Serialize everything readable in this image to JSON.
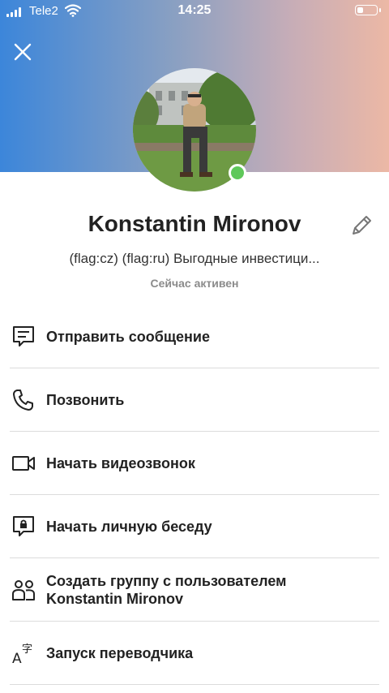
{
  "status_bar": {
    "carrier": "Tele2",
    "time": "14:25",
    "battery_level": 0.35
  },
  "profile": {
    "name": "Konstantin Mironov",
    "mood": "(flag:cz) (flag:ru) Выгодные инвестици...",
    "presence": "Сейчас активен",
    "online": true
  },
  "menu": {
    "items": [
      {
        "label": "Отправить сообщение",
        "icon": "chat-icon"
      },
      {
        "label": "Позвонить",
        "icon": "phone-icon"
      },
      {
        "label": "Начать видеозвонок",
        "icon": "video-icon"
      },
      {
        "label": "Начать личную беседу",
        "icon": "private-chat-icon"
      },
      {
        "label_line1": "Создать группу с пользователем",
        "label_line2": "Konstantin Mironov",
        "icon": "group-icon"
      },
      {
        "label": "Запуск переводчика",
        "icon": "translate-icon"
      }
    ]
  },
  "colors": {
    "header_gradient_start": "#3c86da",
    "header_gradient_end": "#ecb8a5",
    "online": "#5fc85a"
  }
}
